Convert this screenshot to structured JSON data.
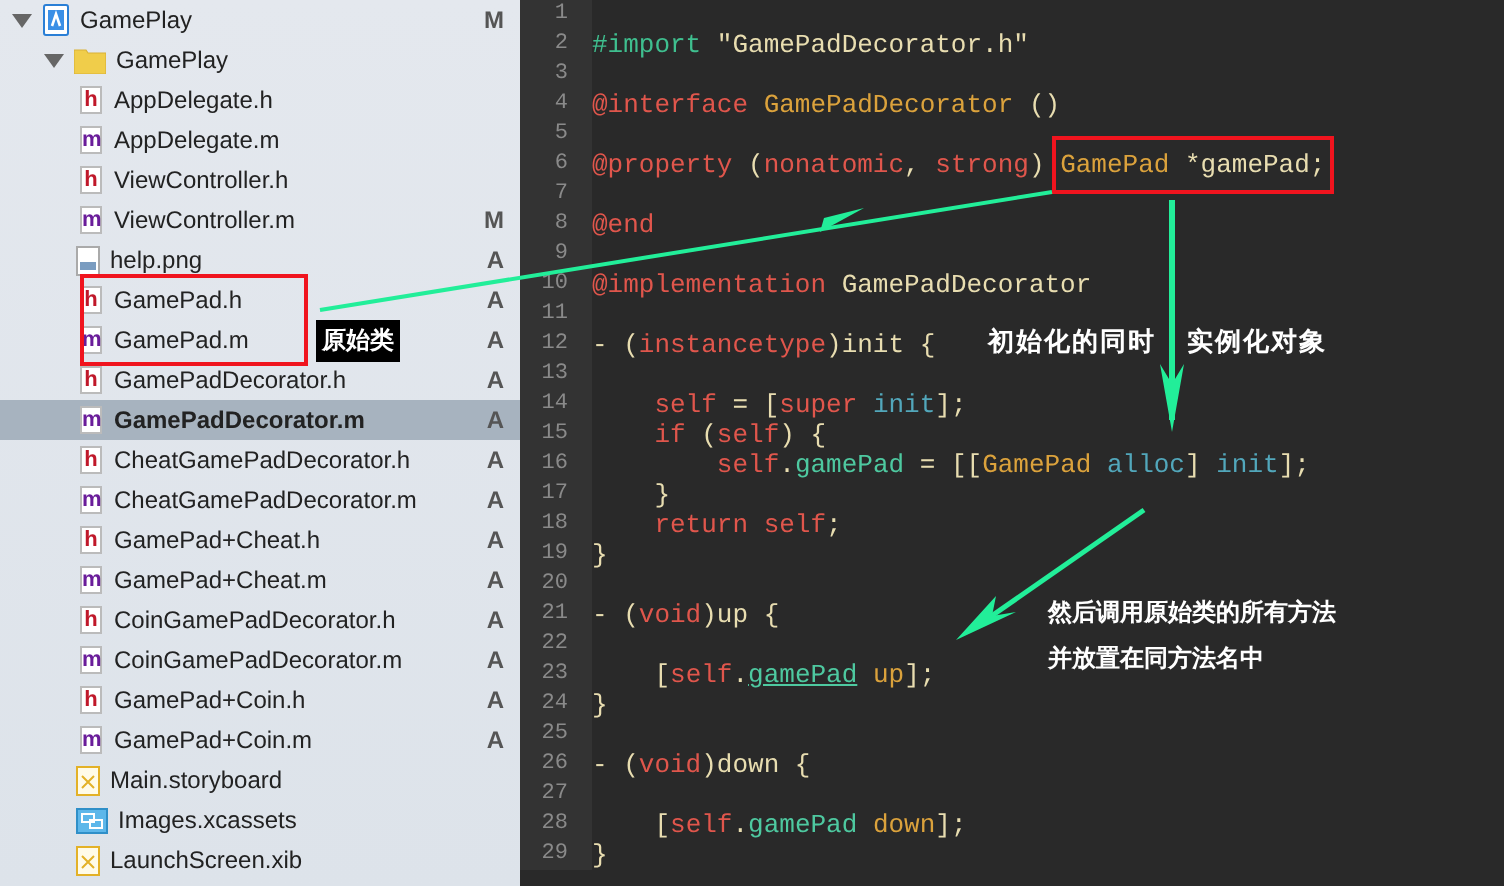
{
  "navigator": {
    "items": [
      {
        "name": "GamePlay",
        "kind": "project",
        "status": "M",
        "expanded": true,
        "selected": false,
        "children": [
          {
            "name": "GamePlay",
            "kind": "folder",
            "expanded": true,
            "selected": false,
            "children": [
              {
                "name": "AppDelegate.h",
                "kind": "source",
                "glyph": "h",
                "selected": false
              },
              {
                "name": "AppDelegate.m",
                "kind": "source",
                "glyph": "m",
                "selected": false
              },
              {
                "name": "ViewController.h",
                "kind": "source",
                "glyph": "h",
                "selected": false
              },
              {
                "name": "ViewController.m",
                "kind": "source",
                "glyph": "m",
                "status": "M",
                "selected": false
              },
              {
                "name": "help.png",
                "kind": "image",
                "status": "A",
                "selected": false
              },
              {
                "name": "GamePad.h",
                "kind": "source",
                "glyph": "h",
                "status": "A",
                "selected": false
              },
              {
                "name": "GamePad.m",
                "kind": "source",
                "glyph": "m",
                "status": "A",
                "selected": false,
                "callout": "原始类"
              },
              {
                "name": "GamePadDecorator.h",
                "kind": "source",
                "glyph": "h",
                "status": "A",
                "selected": false
              },
              {
                "name": "GamePadDecorator.m",
                "kind": "source",
                "glyph": "m",
                "status": "A",
                "selected": true
              },
              {
                "name": "CheatGamePadDecorator.h",
                "kind": "source",
                "glyph": "h",
                "status": "A",
                "selected": false
              },
              {
                "name": "CheatGamePadDecorator.m",
                "kind": "source",
                "glyph": "m",
                "status": "A",
                "selected": false
              },
              {
                "name": "GamePad+Cheat.h",
                "kind": "source",
                "glyph": "h",
                "status": "A",
                "selected": false
              },
              {
                "name": "GamePad+Cheat.m",
                "kind": "source",
                "glyph": "m",
                "status": "A",
                "selected": false
              },
              {
                "name": "CoinGamePadDecorator.h",
                "kind": "source",
                "glyph": "h",
                "status": "A",
                "selected": false
              },
              {
                "name": "CoinGamePadDecorator.m",
                "kind": "source",
                "glyph": "m",
                "status": "A",
                "selected": false
              },
              {
                "name": "GamePad+Coin.h",
                "kind": "source",
                "glyph": "h",
                "status": "A",
                "selected": false
              },
              {
                "name": "GamePad+Coin.m",
                "kind": "source",
                "glyph": "m",
                "status": "A",
                "selected": false
              },
              {
                "name": "Main.storyboard",
                "kind": "storyboard",
                "selected": false
              },
              {
                "name": "Images.xcassets",
                "kind": "assets",
                "selected": false
              },
              {
                "name": "LaunchScreen.xib",
                "kind": "storyboard",
                "selected": false
              }
            ]
          }
        ]
      }
    ]
  },
  "editor": {
    "lines": [
      {
        "number": "1"
      },
      {
        "number": "2",
        "tokens": [
          {
            "kind": "directive",
            "text": "#import"
          },
          {
            "kind": "string",
            "text": " \"GamePadDecorator.h\""
          }
        ]
      },
      {
        "number": "3"
      },
      {
        "number": "4",
        "tokens": [
          {
            "kind": "keyword",
            "text": "@interface"
          },
          {
            "kind": "class",
            "text": " GamePadDecorator"
          },
          {
            "kind": "plain",
            "text": " ()"
          }
        ]
      },
      {
        "number": "5"
      },
      {
        "number": "6",
        "tokens": [
          {
            "kind": "keyword",
            "text": "@property"
          },
          {
            "kind": "plain",
            "text": " ("
          },
          {
            "kind": "keyword",
            "text": "nonatomic"
          },
          {
            "kind": "plain",
            "text": ", "
          },
          {
            "kind": "keyword",
            "text": "strong"
          },
          {
            "kind": "plain",
            "text": ") "
          },
          {
            "kind": "class",
            "text": "GamePad",
            "boxed": true
          },
          {
            "kind": "plain",
            "text": " *gamePad;",
            "boxed": true
          }
        ]
      },
      {
        "number": "7"
      },
      {
        "number": "8",
        "tokens": [
          {
            "kind": "keyword",
            "text": "@end"
          }
        ]
      },
      {
        "number": "9"
      },
      {
        "number": "10",
        "tokens": [
          {
            "kind": "keyword",
            "text": "@implementation"
          },
          {
            "kind": "plain",
            "text": " GamePadDecorator"
          }
        ]
      },
      {
        "number": "11"
      },
      {
        "number": "12",
        "tokens": [
          {
            "kind": "plain",
            "text": "- ("
          },
          {
            "kind": "keyword",
            "text": "instancetype"
          },
          {
            "kind": "plain",
            "text": ")init {"
          }
        ]
      },
      {
        "number": "13"
      },
      {
        "number": "14",
        "tokens": [
          {
            "kind": "keyword",
            "text": "    self"
          },
          {
            "kind": "plain",
            "text": " = ["
          },
          {
            "kind": "keyword",
            "text": "super"
          },
          {
            "kind": "method",
            "text": " init"
          },
          {
            "kind": "plain",
            "text": "];"
          }
        ]
      },
      {
        "number": "15",
        "tokens": [
          {
            "kind": "keyword",
            "text": "    if"
          },
          {
            "kind": "plain",
            "text": " ("
          },
          {
            "kind": "keyword",
            "text": "self"
          },
          {
            "kind": "plain",
            "text": ") {"
          }
        ]
      },
      {
        "number": "16",
        "tokens": [
          {
            "kind": "keyword",
            "text": "        self"
          },
          {
            "kind": "plain",
            "text": "."
          },
          {
            "kind": "property",
            "text": "gamePad"
          },
          {
            "kind": "plain",
            "text": " = [["
          },
          {
            "kind": "class",
            "text": "GamePad"
          },
          {
            "kind": "method",
            "text": " alloc"
          },
          {
            "kind": "plain",
            "text": "]"
          },
          {
            "kind": "method",
            "text": " init"
          },
          {
            "kind": "plain",
            "text": "];"
          }
        ]
      },
      {
        "number": "17",
        "tokens": [
          {
            "kind": "plain",
            "text": "    }"
          }
        ]
      },
      {
        "number": "18",
        "tokens": [
          {
            "kind": "keyword",
            "text": "    return self"
          },
          {
            "kind": "plain",
            "text": ";"
          }
        ]
      },
      {
        "number": "19",
        "tokens": [
          {
            "kind": "plain",
            "text": "}"
          }
        ]
      },
      {
        "number": "20"
      },
      {
        "number": "21",
        "tokens": [
          {
            "kind": "plain",
            "text": "- ("
          },
          {
            "kind": "keyword",
            "text": "void"
          },
          {
            "kind": "plain",
            "text": ")up {"
          }
        ]
      },
      {
        "number": "22"
      },
      {
        "number": "23",
        "tokens": [
          {
            "kind": "plain",
            "text": "    ["
          },
          {
            "kind": "keyword",
            "text": "self"
          },
          {
            "kind": "plain",
            "text": "."
          },
          {
            "kind": "property",
            "text": "gamePad",
            "underlined": true
          },
          {
            "kind": "class",
            "text": " up"
          },
          {
            "kind": "plain",
            "text": "];"
          }
        ]
      },
      {
        "number": "24",
        "tokens": [
          {
            "kind": "plain",
            "text": "}"
          }
        ]
      },
      {
        "number": "25"
      },
      {
        "number": "26",
        "tokens": [
          {
            "kind": "plain",
            "text": "- ("
          },
          {
            "kind": "keyword",
            "text": "void"
          },
          {
            "kind": "plain",
            "text": ")down {"
          }
        ]
      },
      {
        "number": "27"
      },
      {
        "number": "28",
        "tokens": [
          {
            "kind": "plain",
            "text": "    ["
          },
          {
            "kind": "keyword",
            "text": "self"
          },
          {
            "kind": "plain",
            "text": "."
          },
          {
            "kind": "property",
            "text": "gamePad"
          },
          {
            "kind": "class",
            "text": " down"
          },
          {
            "kind": "plain",
            "text": "];"
          }
        ]
      },
      {
        "number": "29",
        "tokens": [
          {
            "kind": "plain",
            "text": "}"
          }
        ]
      }
    ]
  },
  "annotations": {
    "init_note": "初始化的同时 实例化对象",
    "forward_note": [
      "然后调用原始类的所有方法",
      "并放置在同方法名中"
    ]
  }
}
